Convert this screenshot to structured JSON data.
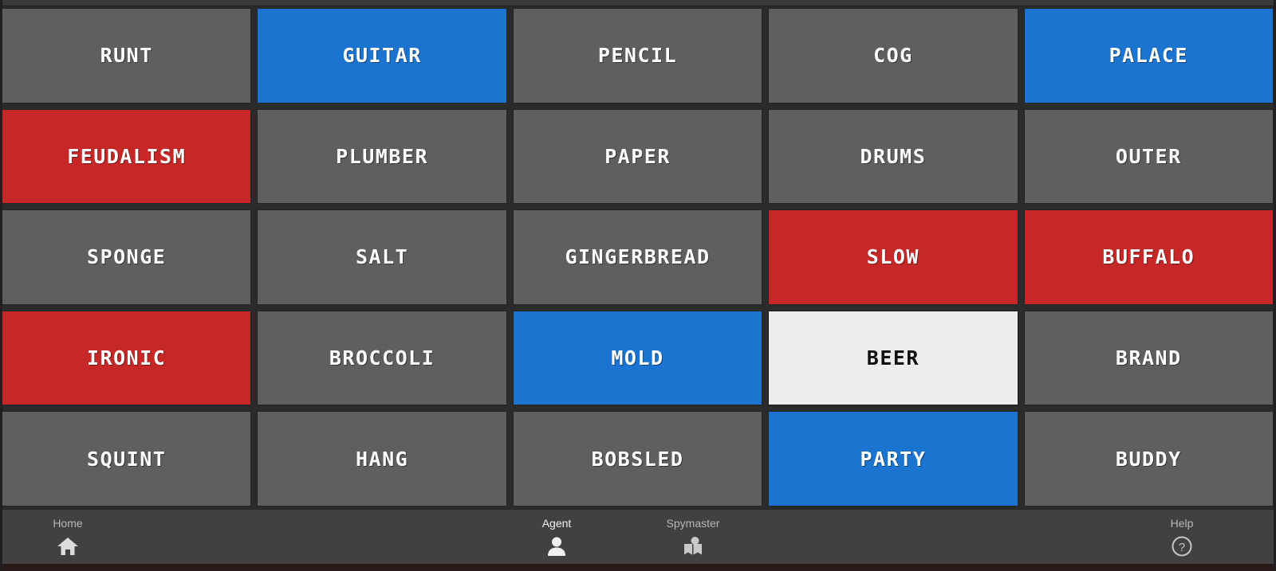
{
  "board": {
    "rows": 5,
    "cols": 5,
    "colors": {
      "neutral": "#5f5f5f",
      "blue": "#1b75d0",
      "red": "#c62828",
      "white": "#ededed",
      "background": "#2b2b2b",
      "toolbar": "#414141"
    },
    "cards": [
      {
        "word": "RUNT",
        "type": "neutral"
      },
      {
        "word": "GUITAR",
        "type": "blue"
      },
      {
        "word": "PENCIL",
        "type": "neutral"
      },
      {
        "word": "COG",
        "type": "neutral"
      },
      {
        "word": "PALACE",
        "type": "blue"
      },
      {
        "word": "FEUDALISM",
        "type": "red"
      },
      {
        "word": "PLUMBER",
        "type": "neutral"
      },
      {
        "word": "PAPER",
        "type": "neutral"
      },
      {
        "word": "DRUMS",
        "type": "neutral"
      },
      {
        "word": "OUTER",
        "type": "neutral"
      },
      {
        "word": "SPONGE",
        "type": "neutral"
      },
      {
        "word": "SALT",
        "type": "neutral"
      },
      {
        "word": "GINGERBREAD",
        "type": "neutral"
      },
      {
        "word": "SLOW",
        "type": "red"
      },
      {
        "word": "BUFFALO",
        "type": "red"
      },
      {
        "word": "IRONIC",
        "type": "red"
      },
      {
        "word": "BROCCOLI",
        "type": "neutral"
      },
      {
        "word": "MOLD",
        "type": "blue"
      },
      {
        "word": "BEER",
        "type": "white"
      },
      {
        "word": "BRAND",
        "type": "neutral"
      },
      {
        "word": "SQUINT",
        "type": "neutral"
      },
      {
        "word": "HANG",
        "type": "neutral"
      },
      {
        "word": "BOBSLED",
        "type": "neutral"
      },
      {
        "word": "PARTY",
        "type": "blue"
      },
      {
        "word": "BUDDY",
        "type": "neutral"
      }
    ]
  },
  "toolbar": {
    "items": [
      {
        "label": "Home",
        "icon": "home-icon",
        "active": false
      },
      {
        "label": "Agent",
        "icon": "person-icon",
        "active": true
      },
      {
        "label": "Spymaster",
        "icon": "spymaster-icon",
        "active": false
      },
      {
        "label": "Help",
        "icon": "help-icon",
        "active": false
      }
    ]
  }
}
